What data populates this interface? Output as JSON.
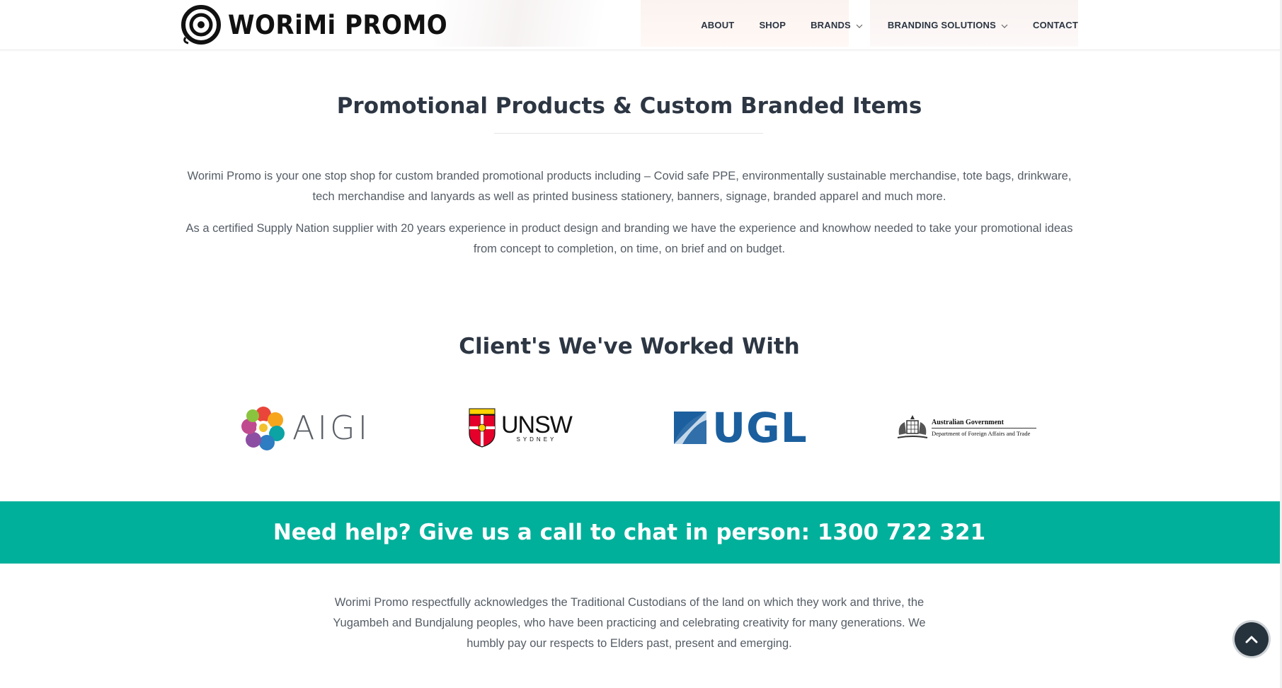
{
  "header": {
    "logo_text": "WORiMi PROMO",
    "nav": [
      {
        "label": "ABOUT",
        "has_dropdown": false
      },
      {
        "label": "SHOP",
        "has_dropdown": false
      },
      {
        "label": "BRANDS",
        "has_dropdown": true
      },
      {
        "label": "BRANDING SOLUTIONS",
        "has_dropdown": true
      },
      {
        "label": "CONTACT",
        "has_dropdown": false
      }
    ]
  },
  "intro": {
    "title": "Promotional Products & Custom Branded Items",
    "paragraph1": "Worimi Promo is your one stop shop for custom branded promotional products including – Covid safe PPE, environmentally sustainable merchandise, tote bags, drinkware, tech merchandise and lanyards as well as printed business stationery, banners, signage, branded apparel and much more.",
    "paragraph2": "As a certified Supply Nation supplier with 20 years experience in product design and branding we have the experience and knowhow needed to take your promotional ideas from concept to completion, on time, on brief and on budget."
  },
  "clients": {
    "title": "Client's We've Worked With",
    "logos": {
      "aigi": {
        "text": "AIGI"
      },
      "unsw": {
        "text": "UNSW",
        "subtext": "SYDNEY"
      },
      "ugl": {
        "text": "UGL"
      },
      "gov": {
        "line1": "Australian Government",
        "line2": "Department of Foreign Affairs and Trade"
      }
    }
  },
  "cta": {
    "text": "Need help? Give us a call to chat in person: 1300 722 321"
  },
  "acknowledgement": "Worimi Promo respectfully acknowledges the Traditional Custodians of the land on which they work and thrive, the Yugambeh and Bundjalung peoples, who have been practicing and celebrating creativity for many generations. We humbly pay our respects to Elders past, present and emerging.",
  "icons": {
    "scroll_top": "chevron-up-icon",
    "dropdown": "chevron-down-icon"
  },
  "colors": {
    "accent": "#00b09b",
    "heading": "#2d3643",
    "body_text": "#555d66",
    "scroll_button": "#26333d",
    "ugl_blue": "#1b5f9e"
  }
}
